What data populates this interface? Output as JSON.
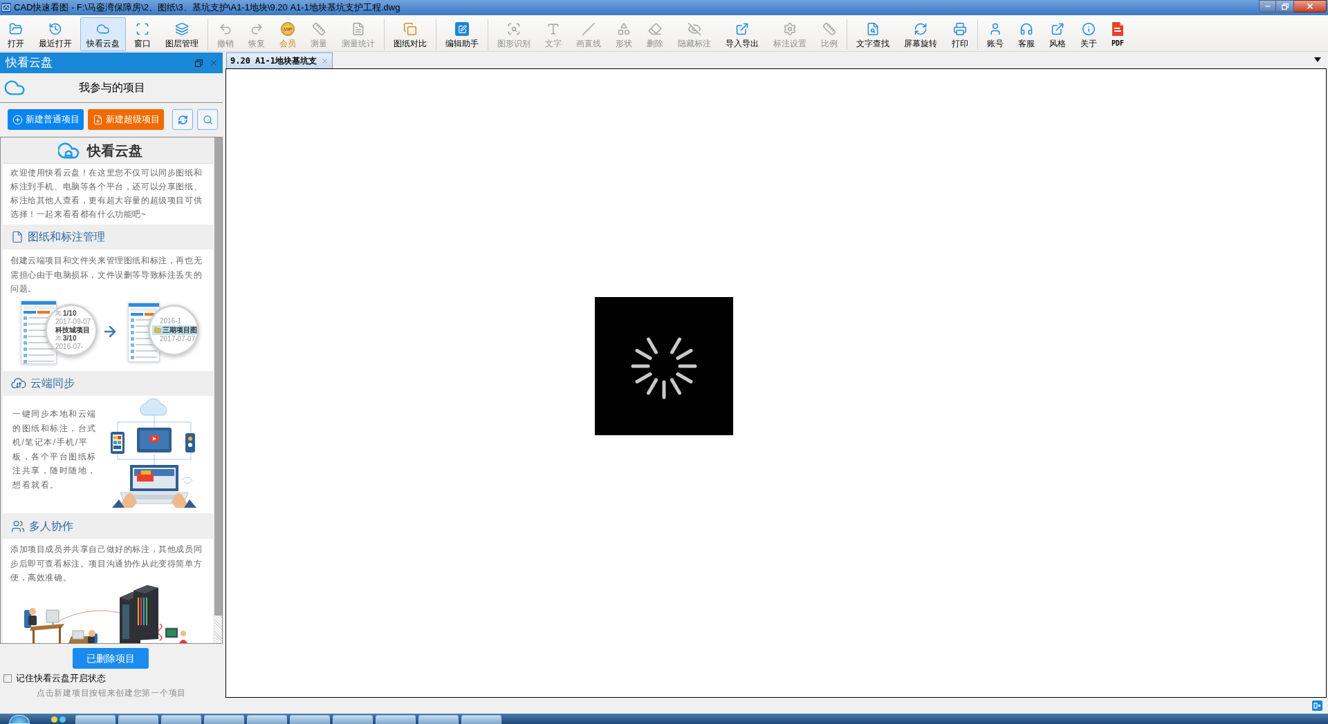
{
  "window": {
    "title": "CAD快速看图 - F:\\马銮湾保障房\\2、图纸\\3、基坑支护\\A1-1地块\\9.20 A1-1地块基坑支护工程.dwg"
  },
  "toolbar": {
    "groups": [
      [
        {
          "label": "打开",
          "disabled": false,
          "selected": false
        },
        {
          "label": "最近打开",
          "disabled": false,
          "selected": false
        },
        {
          "label": "快看云盘",
          "disabled": false,
          "selected": true
        },
        {
          "label": "窗口",
          "disabled": false,
          "selected": false
        },
        {
          "label": "图层管理",
          "disabled": false,
          "selected": false
        }
      ],
      [
        {
          "label": "撤销",
          "disabled": true,
          "selected": false
        },
        {
          "label": "恢复",
          "disabled": true,
          "selected": false
        },
        {
          "label": "会员",
          "badge": "VIP",
          "disabled": false,
          "selected": false
        },
        {
          "label": "测量",
          "disabled": true,
          "selected": false
        },
        {
          "label": "测量统计",
          "disabled": true,
          "selected": false
        }
      ],
      [
        {
          "label": "图纸对比",
          "disabled": false,
          "selected": false
        }
      ],
      [
        {
          "label": "编辑助手",
          "disabled": false,
          "selected": false
        }
      ],
      [
        {
          "label": "图形识别",
          "disabled": true,
          "selected": false
        },
        {
          "label": "文字",
          "disabled": true,
          "selected": false
        },
        {
          "label": "画直线",
          "disabled": true,
          "selected": false
        },
        {
          "label": "形状",
          "disabled": true,
          "selected": false
        },
        {
          "label": "删除",
          "disabled": true,
          "selected": false
        },
        {
          "label": "隐藏标注",
          "disabled": true,
          "selected": false
        },
        {
          "label": "导入导出",
          "disabled": false,
          "selected": false
        },
        {
          "label": "标注设置",
          "disabled": true,
          "selected": false
        },
        {
          "label": "比例",
          "disabled": true,
          "selected": false
        }
      ],
      [
        {
          "label": "文字查找",
          "disabled": false,
          "selected": false
        },
        {
          "label": "屏幕旋转",
          "disabled": false,
          "selected": false
        },
        {
          "label": "打印",
          "disabled": false,
          "selected": false
        }
      ],
      [
        {
          "label": "账号",
          "disabled": false,
          "selected": false
        },
        {
          "label": "客服",
          "disabled": false,
          "selected": false
        },
        {
          "label": "风格",
          "disabled": false,
          "selected": false
        },
        {
          "label": "关于",
          "disabled": false,
          "selected": false
        },
        {
          "label": "PDF",
          "disabled": false,
          "selected": false
        }
      ]
    ]
  },
  "side_panel": {
    "title": "快看云盘",
    "project_heading": "我参与的项目",
    "buttons": [
      {
        "kind": "normal",
        "label": "新建普通项目"
      },
      {
        "kind": "super",
        "label": "新建超级项目"
      }
    ],
    "intro": {
      "title": "快看云盘",
      "text": "欢迎使用快看云盘！在这里您不仅可以同步图纸和标注到手机、电脑等各个平台，还可以分享图纸、标注给其他人查看，更有超大容量的超级项目可供选择！一起来看看都有什么功能吧~"
    },
    "sections": [
      {
        "kind": "management",
        "title": "图纸和标注管理",
        "text": "创建云端项目和文件夹来管理图纸和标注，再也无需担心由于电脑损坏，文件误删等导致标注丢失的问题。",
        "magnifiers": [
          [
            {
              "kind": "count",
              "text": "1/10"
            },
            {
              "kind": "date",
              "text": "2017-09-07"
            },
            {
              "kind": "name",
              "text": "科技城项目"
            },
            {
              "kind": "count",
              "text": "3/10"
            },
            {
              "kind": "date",
              "text": "2016-07-"
            }
          ],
          [
            {
              "kind": "date",
              "text": "2016-1"
            },
            {
              "kind": "folder",
              "text": "三期项目图"
            },
            {
              "kind": "date",
              "text": "2017-07-07"
            }
          ]
        ]
      },
      {
        "kind": "sync",
        "title": "云端同步",
        "text": "一键同步本地和云端的图纸和标注，台式机/笔记本/手机/平板，各个平台图纸标注共享，随时随地，想看就看。"
      },
      {
        "kind": "team",
        "title": "多人协作",
        "text": "添加项目成员并共享自己做好的标注，其他成员同步后即可查看标注。项目沟通协作从此变得简单方便，高效准确。"
      }
    ],
    "deleted_button": "已删除项目",
    "remember": {
      "label": "记住快看云盘开启状态",
      "checked": false
    },
    "hint": "点击新建项目按钮来创建您第一个项目"
  },
  "document_tabs": [
    {
      "label": "9.20 A1-1地块基坑支",
      "selected": true
    }
  ],
  "canvas": {
    "loading": true
  }
}
